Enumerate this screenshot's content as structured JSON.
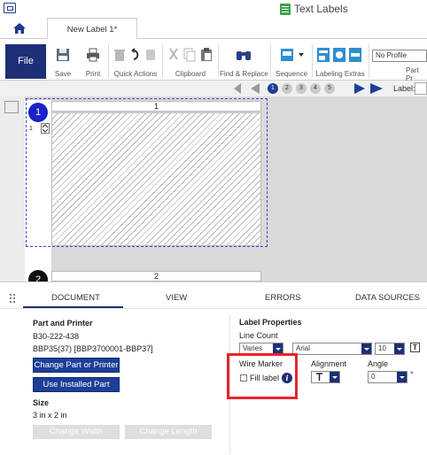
{
  "window": {
    "title": "Text Labels"
  },
  "tabs": {
    "home_icon": "home-icon",
    "document_tab": "New Label 1*"
  },
  "ribbon": {
    "file": "File",
    "save": "Save",
    "print": "Print",
    "quick_actions": "Quick Actions",
    "clipboard": "Clipboard",
    "find_replace": "Find & Replace",
    "sequence": "Sequence",
    "labeling_extras": "Labeling Extras",
    "profile_value": "No Profile",
    "part_pr": "Part Pr"
  },
  "pager": {
    "pages": [
      "1",
      "2",
      "3",
      "4",
      "5"
    ],
    "current_page": "1",
    "label_field_label": "Label:"
  },
  "canvas": {
    "ruler_top": "1",
    "ruler_bottom": "2",
    "label_badge_1": "1",
    "label_badge_2": "2",
    "quantity": "1"
  },
  "panel_tabs": [
    "DOCUMENT",
    "VIEW",
    "ERRORS",
    "DATA SOURCES"
  ],
  "document": {
    "part_heading": "Part and Printer",
    "part_number": "B30-222-438",
    "part_range": "BBP35(37) [BBP3700001-BBP37]",
    "change_part_btn": "Change Part or Printer",
    "use_installed_btn": "Use Installed Part",
    "size_heading": "Size",
    "size_value": "3 in x 2 in",
    "change_width_btn": "Change Width",
    "change_length_btn": "Change Length"
  },
  "label_properties": {
    "heading": "Label Properties",
    "line_count_label": "Line Count",
    "line_count_value": "Varies",
    "font_value": "Arial",
    "font_size_value": "10",
    "wire_marker_label": "Wire Marker",
    "fill_label_text": "Fill label",
    "fill_label_checked": false,
    "alignment_label": "Alignment",
    "alignment_icon": "text-align-icon",
    "angle_label": "Angle",
    "angle_value": "0",
    "angle_unit": "°"
  },
  "colors": {
    "brand_navy": "#1c2f77",
    "selection_blue": "#1b22c8",
    "highlight_red": "#e8242b"
  }
}
